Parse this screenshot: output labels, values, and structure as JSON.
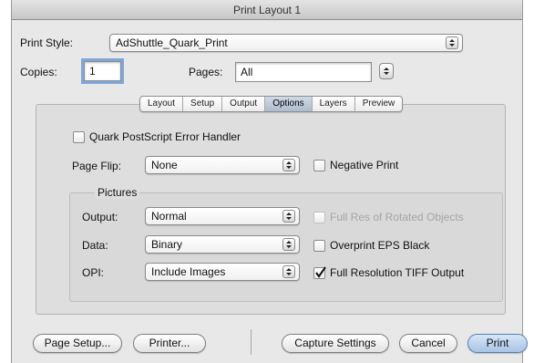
{
  "window": {
    "title": "Print Layout 1"
  },
  "print_style": {
    "label": "Print Style:",
    "value": "AdShuttle_Quark_Print"
  },
  "copies": {
    "label": "Copies:",
    "value": "1"
  },
  "pages": {
    "label": "Pages:",
    "value": "All"
  },
  "tabs": [
    "Layout",
    "Setup",
    "Output",
    "Options",
    "Layers",
    "Preview"
  ],
  "active_tab": "Options",
  "options": {
    "postscript_error_handler": {
      "label": "Quark PostScript Error Handler",
      "checked": false
    },
    "page_flip": {
      "label": "Page Flip:",
      "value": "None"
    },
    "negative_print": {
      "label": "Negative Print",
      "checked": false
    }
  },
  "pictures": {
    "title": "Pictures",
    "output": {
      "label": "Output:",
      "value": "Normal"
    },
    "data": {
      "label": "Data:",
      "value": "Binary"
    },
    "opi": {
      "label": "OPI:",
      "value": "Include Images"
    },
    "full_res_rotated": {
      "label": "Full Res of Rotated Objects",
      "checked": false,
      "enabled": false
    },
    "overprint_eps_black": {
      "label": "Overprint EPS Black",
      "checked": false
    },
    "full_res_tiff": {
      "label": "Full Resolution TIFF Output",
      "checked": true
    }
  },
  "buttons": {
    "page_setup": "Page Setup...",
    "printer": "Printer...",
    "capture_settings": "Capture Settings",
    "cancel": "Cancel",
    "print": "Print"
  },
  "colors": {
    "default_button": "#a7c4e6",
    "focus_ring": "#7fa6d8"
  }
}
